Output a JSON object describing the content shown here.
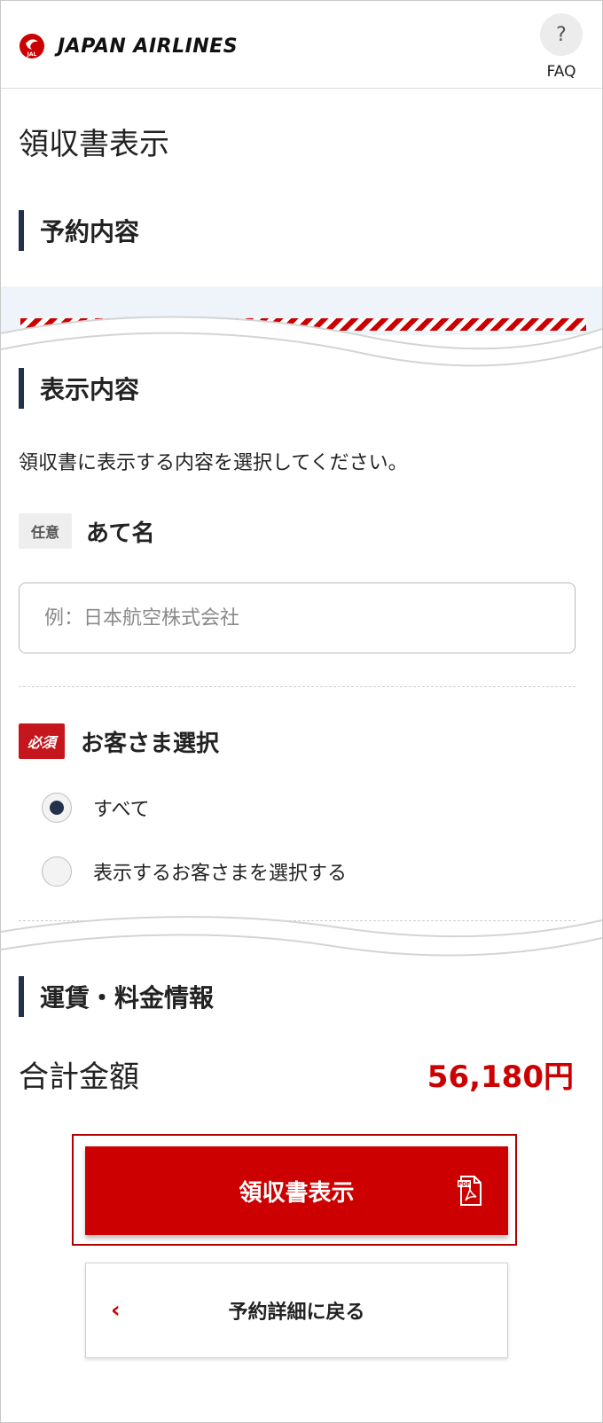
{
  "header": {
    "brand": "JAPAN AIRLINES",
    "logo_text": "JAL",
    "faq_icon": "?",
    "faq_label": "FAQ"
  },
  "page_title": "領収書表示",
  "sections": {
    "reservation": "予約内容",
    "display": "表示内容",
    "fare": "運賃・料金情報"
  },
  "display": {
    "description": "領収書に表示する内容を選択してください。",
    "addressee": {
      "tag": "任意",
      "label": "あて名",
      "placeholder": "例：日本航空株式会社",
      "value": ""
    },
    "customer": {
      "tag": "必須",
      "label": "お客さま選択",
      "options": [
        {
          "label": "すべて",
          "selected": true
        },
        {
          "label": "表示するお客さまを選択する",
          "selected": false
        }
      ]
    }
  },
  "fare": {
    "total_label": "合計金額",
    "total_value": "56,180円"
  },
  "buttons": {
    "show_receipt": "領収書表示",
    "pdf_badge": "PDF",
    "back": "予約詳細に戻る",
    "back_icon": "‹"
  },
  "colors": {
    "brand_red": "#cc0000",
    "navy": "#24314d"
  }
}
